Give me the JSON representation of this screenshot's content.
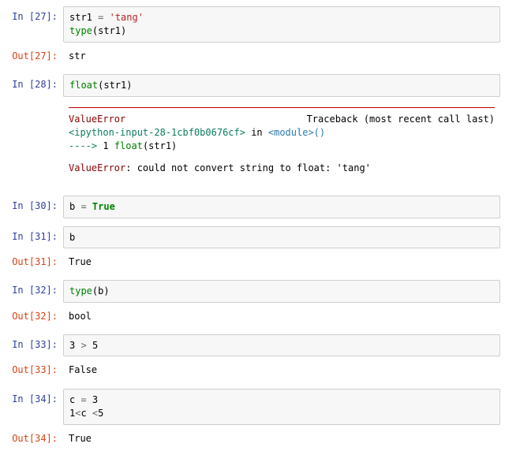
{
  "cells": [
    {
      "in_prompt": "In  [27]:",
      "code_tokens": [
        [
          "str1 ",
          "var"
        ],
        [
          "=",
          "op"
        ],
        [
          " ",
          "var"
        ],
        [
          "'tang'",
          "str"
        ],
        [
          "\n",
          "var"
        ],
        [
          "type",
          "bi"
        ],
        [
          "(str1)",
          "var"
        ]
      ],
      "out_prompt": "Out[27]:",
      "out_text": "str"
    },
    {
      "in_prompt": "In  [28]:",
      "code_tokens": [
        [
          "float",
          "bi"
        ],
        [
          "(str1)",
          "var"
        ]
      ],
      "traceback": {
        "err_name": "ValueError",
        "tb_label": "Traceback (most recent call last)",
        "file_ref": "<ipython-input-28-1cbf0b0676cf>",
        "in_word": " in ",
        "module_ref": "<module>",
        "parens": "()",
        "arrow": "----> ",
        "lineno": "1 ",
        "call_tokens": [
          [
            "float",
            "bi"
          ],
          [
            "(str1)",
            "var"
          ]
        ],
        "final_err": "ValueError",
        "final_msg": ": could not convert string to float: 'tang'"
      }
    },
    {
      "in_prompt": "In  [30]:",
      "code_tokens": [
        [
          "b ",
          "var"
        ],
        [
          "=",
          "op"
        ],
        [
          " ",
          "var"
        ],
        [
          "True",
          "kw"
        ]
      ]
    },
    {
      "in_prompt": "In  [31]:",
      "code_tokens": [
        [
          "b",
          "var"
        ]
      ],
      "out_prompt": "Out[31]:",
      "out_text": "True"
    },
    {
      "in_prompt": "In  [32]:",
      "code_tokens": [
        [
          "type",
          "bi"
        ],
        [
          "(b)",
          "var"
        ]
      ],
      "out_prompt": "Out[32]:",
      "out_text": "bool"
    },
    {
      "in_prompt": "In  [33]:",
      "code_tokens": [
        [
          "3",
          "var"
        ],
        [
          " ",
          "var"
        ],
        [
          ">",
          "op"
        ],
        [
          " ",
          "var"
        ],
        [
          "5",
          "var"
        ]
      ],
      "out_prompt": "Out[33]:",
      "out_text": "False"
    },
    {
      "in_prompt": "In  [34]:",
      "code_tokens": [
        [
          "c ",
          "var"
        ],
        [
          "=",
          "op"
        ],
        [
          " ",
          "var"
        ],
        [
          "3",
          "var"
        ],
        [
          "\n",
          "var"
        ],
        [
          "1",
          "var"
        ],
        [
          "<",
          "op"
        ],
        [
          "c ",
          "var"
        ],
        [
          "<",
          "op"
        ],
        [
          "5",
          "var"
        ]
      ],
      "out_prompt": "Out[34]:",
      "out_text": "True"
    }
  ]
}
